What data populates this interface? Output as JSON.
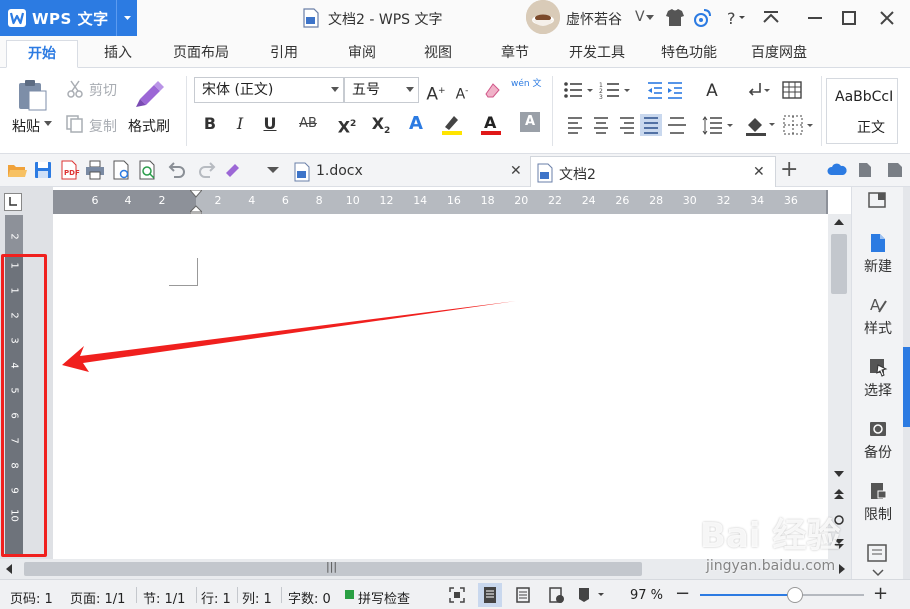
{
  "app": {
    "name": "WPS 文字",
    "doc_title": "文档2 - WPS 文字",
    "user_name": "虚怀若谷"
  },
  "ribbon_tabs": [
    "开始",
    "插入",
    "页面布局",
    "引用",
    "审阅",
    "视图",
    "章节",
    "开发工具",
    "特色功能",
    "百度网盘"
  ],
  "ribbon": {
    "paste": "粘贴",
    "cut": "剪切",
    "copy": "复制",
    "format_painter": "格式刷",
    "font": "宋体 (正文)",
    "size": "五号",
    "style_preview": "AaBbCcI",
    "style_name": "正文",
    "pinyin": "wén 文"
  },
  "doc_tabs": [
    {
      "label": "1.docx"
    },
    {
      "label": "文档2"
    }
  ],
  "ruler": {
    "h_left": [
      "6",
      "4",
      "2"
    ],
    "h_right": [
      "2",
      "4",
      "6",
      "8",
      "10",
      "12",
      "14",
      "16",
      "18",
      "20",
      "22",
      "24",
      "26",
      "28",
      "30",
      "32",
      "34",
      "36"
    ],
    "v_top": [
      "2"
    ],
    "v_body": [
      "1",
      "1",
      "2",
      "3",
      "4",
      "5",
      "6",
      "7",
      "8",
      "9",
      "10"
    ]
  },
  "task_pane": [
    "新建",
    "样式",
    "选择",
    "备份",
    "限制"
  ],
  "status": {
    "page_no": "页码: 1",
    "pages": "页面: 1/1",
    "section": "节: 1/1",
    "row": "行: 1",
    "col": "列: 1",
    "words": "字数: 0",
    "spell": "拼写检查",
    "zoom": "97 %",
    "zoom_level": 0.58
  },
  "watermark": {
    "logo": "Bai 经验",
    "url": "jingyan.baidu.com"
  },
  "colors": {
    "accent": "#2c7be2",
    "annotation": "#f0201e"
  }
}
